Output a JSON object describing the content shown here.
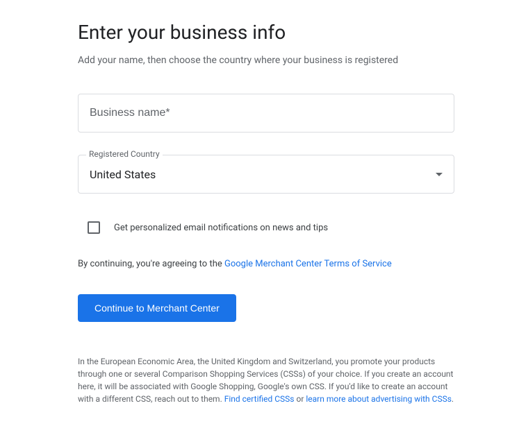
{
  "header": {
    "title": "Enter your business info",
    "subtitle": "Add your name, then choose the country where your business is registered"
  },
  "form": {
    "businessName": {
      "placeholder": "Business name*",
      "value": ""
    },
    "registeredCountry": {
      "label": "Registered Country",
      "value": "United States"
    },
    "emailCheckbox": {
      "label": "Get personalized email notifications on news and tips",
      "checked": false
    }
  },
  "terms": {
    "prefix": "By continuing, you're agreeing to the ",
    "linkText": "Google Merchant Center Terms of Service"
  },
  "button": {
    "label": "Continue to Merchant Center"
  },
  "disclaimer": {
    "text1": "In the European Economic Area, the United Kingdom and Switzerland, you promote your products through one or several Comparison Shopping Services (CSSs) of your choice. If you create an account here, it will be associated with Google Shopping, Google's own CSS. If you'd like to create an account with a different CSS, reach out to them. ",
    "link1": "Find certified CSSs",
    "middle": " or ",
    "link2": "learn more about advertising with CSSs",
    "suffix": "."
  }
}
